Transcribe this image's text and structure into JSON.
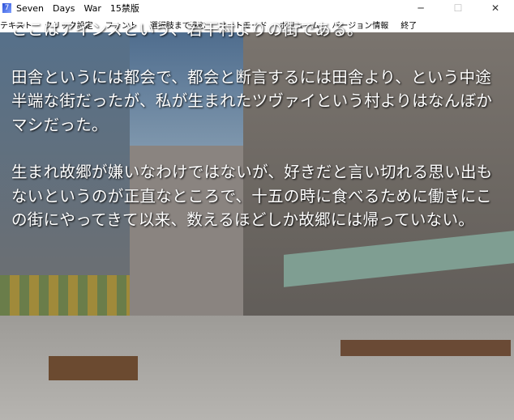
{
  "window": {
    "title": "Seven　Days　War　15禁版",
    "icon": "app-icon",
    "minimize": "─",
    "maximize": "☐",
    "close": "✕"
  },
  "menu": [
    "テキスト",
    "クリック設定",
    "フォント",
    "選択肢まで進む",
    "オートモード",
    "ボリューム",
    "バージョン情報",
    "終了"
  ],
  "story": {
    "p1": "ここはアインスという、若干村よりの街である。",
    "p2": "田舎というには都会で、都会と断言するには田舎より、という中途半端な街だったが、私が生まれたツヴァイという村よりはなんぼかマシだった。",
    "p3": "生まれ故郷が嫌いなわけではないが、好きだと言い切れる思い出もないというのが正直なところで、十五の時に食べるために働きにこの街にやってきて以来、数えるほどしか故郷には帰っていない。"
  }
}
